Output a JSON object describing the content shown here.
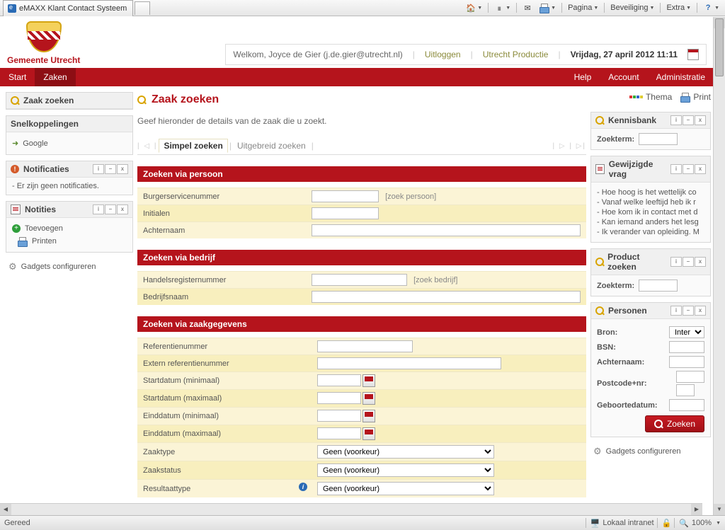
{
  "ie": {
    "tab_title": "eMAXX Klant Contact Systeem",
    "menu": {
      "pagina": "Pagina",
      "beveiliging": "Beveiliging",
      "extra": "Extra"
    },
    "status_left": "Gereed",
    "status_zone": "Lokaal intranet",
    "zoom": "100%"
  },
  "header": {
    "org": "Gemeente Utrecht",
    "welcome": "Welkom, Joyce de Gier (j.de.gier@utrecht.nl)",
    "logout": "Uitloggen",
    "env": "Utrecht Productie",
    "date": "Vrijdag, 27 april 2012 11:11"
  },
  "nav": {
    "start": "Start",
    "zaken": "Zaken",
    "help": "Help",
    "account": "Account",
    "admin": "Administratie"
  },
  "left": {
    "zoek_title": "Zaak zoeken",
    "snel_title": "Snelkoppelingen",
    "google": "Google",
    "notif_title": "Notificaties",
    "notif_empty": "- Er zijn geen notificaties.",
    "notes_title": "Notities",
    "toevoegen": "Toevoegen",
    "printen": "Printen",
    "gadgets": "Gadgets configureren"
  },
  "main": {
    "title": "Zaak zoeken",
    "sub": "Geef hieronder de details van de zaak die u zoekt.",
    "tab_simple": "Simpel zoeken",
    "tab_adv": "Uitgebreid zoeken",
    "sec_persoon": "Zoeken via persoon",
    "f_bsn": "Burgerservicenummer",
    "link_persoon": "[zoek persoon]",
    "f_init": "Initialen",
    "f_achternaam": "Achternaam",
    "sec_bedrijf": "Zoeken via bedrijf",
    "f_handels": "Handelsregisternummer",
    "link_bedrijf": "[zoek bedrijf]",
    "f_bedrijfsnaam": "Bedrijfsnaam",
    "sec_zaak": "Zoeken via zaakgegevens",
    "f_ref": "Referentienummer",
    "f_extref": "Extern referentienummer",
    "f_start_min": "Startdatum (minimaal)",
    "f_start_max": "Startdatum (maximaal)",
    "f_eind_min": "Einddatum (minimaal)",
    "f_eind_max": "Einddatum (maximaal)",
    "f_zaaktype": "Zaaktype",
    "f_zaakstatus": "Zaakstatus",
    "f_resultaat": "Resultaattype",
    "opt_default": "Geen (voorkeur)",
    "btn_zoeken": "Zoeken"
  },
  "right": {
    "thema": "Thema",
    "print": "Print",
    "kb_title": "Kennisbank",
    "zoekterm": "Zoekterm:",
    "faq_title": "Gewijzigde vrag",
    "faq": [
      "- Hoe hoog is het wettelijk co",
      "- Vanaf welke leeftijd heb ik r",
      "- Hoe kom ik in contact met d",
      "- Kan iemand anders het lesg",
      "- Ik verander van opleiding. M"
    ],
    "prod_title": "Product zoeken",
    "pers_title": "Personen",
    "p_bron": "Bron:",
    "p_bron_val": "Intern",
    "p_bsn": "BSN:",
    "p_achternaam": "Achternaam:",
    "p_postcode": "Postcode+nr:",
    "p_geboorte": "Geboortedatum:",
    "gadgets": "Gadgets configureren"
  }
}
